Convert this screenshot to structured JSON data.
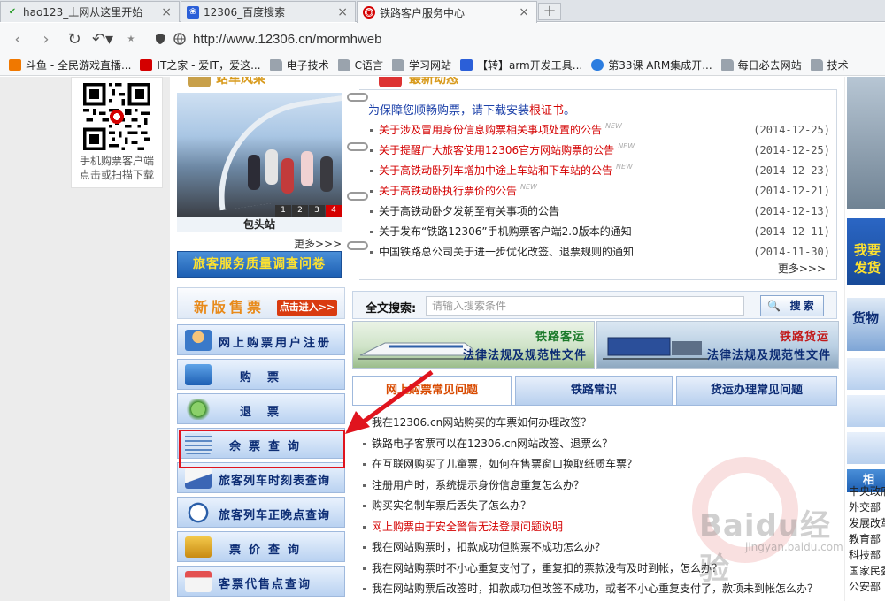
{
  "tabs": [
    {
      "title": "hao123_上网从这里开始",
      "favicon": "hao123-icon"
    },
    {
      "title": "12306_百度搜索",
      "favicon": "baidu-paw-icon"
    },
    {
      "title": "铁路客户服务中心",
      "favicon": "railway-icon"
    }
  ],
  "address": {
    "url": "http://www.12306.cn/mormhweb"
  },
  "bookmarks": [
    {
      "label": "斗鱼 - 全民游戏直播...",
      "icon": "douyu-icon"
    },
    {
      "label": "IT之家 - 爱IT，爱这...",
      "icon": "ithome-icon"
    },
    {
      "label": "电子技术",
      "icon": "folder-icon"
    },
    {
      "label": "C语言",
      "icon": "folder-icon"
    },
    {
      "label": "学习网站",
      "icon": "folder-icon"
    },
    {
      "label": "【转】arm开发工具...",
      "icon": "baidu-paw-icon"
    },
    {
      "label": "第33课 ARM集成开...",
      "icon": "video-icon"
    },
    {
      "label": "每日必去网站",
      "icon": "folder-icon"
    },
    {
      "label": "技术",
      "icon": "folder-icon"
    }
  ],
  "qr": {
    "caption_line1": "手机购票客户端",
    "caption_line2": "点击或扫描下载"
  },
  "headings": {
    "station_scenery": "站车风采",
    "latest_news": "最新动态"
  },
  "photo": {
    "caption": "包头站",
    "pages": [
      "1",
      "2",
      "3",
      "4"
    ],
    "active_page": "4",
    "more": "更多>>>"
  },
  "survey_button": "旅客服务质量调查问卷",
  "notice": {
    "prefix": "为保障您顺畅购票，请下载安装",
    "link": "根证书",
    "suffix": "。"
  },
  "news": [
    {
      "title": "关于涉及冒用身份信息购票相关事项处置的公告",
      "date": "(2014-12-25)",
      "hot": true,
      "new": "NEW"
    },
    {
      "title": "关于提醒广大旅客使用12306官方网站购票的公告",
      "date": "(2014-12-25)",
      "hot": true,
      "new": "NEW"
    },
    {
      "title": "关于高铁动卧列车增加中途上车站和下车站的公告",
      "date": "(2014-12-23)",
      "hot": true,
      "new": "NEW"
    },
    {
      "title": "关于高铁动卧执行票价的公告",
      "date": "(2014-12-21)",
      "hot": true,
      "new": "NEW"
    },
    {
      "title": "关于高铁动卧夕发朝至有关事项的公告",
      "date": "(2014-12-13)",
      "hot": false,
      "new": ""
    },
    {
      "title": "关于发布“铁路12306”手机购票客户端2.0版本的通知",
      "date": "(2014-12-11)",
      "hot": false,
      "new": ""
    },
    {
      "title": "中国铁路总公司关于进一步优化改签、退票规则的通知",
      "date": "(2014-11-30)",
      "hot": false,
      "new": ""
    }
  ],
  "news_more": "更多>>>",
  "new_booking": {
    "title": "新版售票",
    "button": "点击进入>>"
  },
  "menu": [
    {
      "label": "网上购票用户注册",
      "icon": "user-register-icon"
    },
    {
      "label": "购票",
      "icon": "ticket-computer-icon"
    },
    {
      "label": "退票",
      "icon": "refund-arrow-icon"
    },
    {
      "label": "余票查询",
      "icon": "remaining-tickets-icon"
    },
    {
      "label": "旅客列车时刻表查询",
      "icon": "train-timetable-icon"
    },
    {
      "label": "旅客列车正晚点查询",
      "icon": "clock-icon"
    },
    {
      "label": "票价查询",
      "icon": "yen-price-icon"
    },
    {
      "label": "客票代售点查询",
      "icon": "shop-icon"
    }
  ],
  "search": {
    "label": "全文搜索:",
    "placeholder": "请输入搜索条件",
    "button": "搜索"
  },
  "banners": [
    {
      "title": "铁路客运",
      "subtitle": "法律法规及规范性文件"
    },
    {
      "title": "铁路货运",
      "subtitle": "法律法规及规范性文件"
    }
  ],
  "faq_tabs": [
    "网上购票常见问题",
    "铁路常识",
    "货运办理常见问题"
  ],
  "faq": [
    {
      "q": "我在12306.cn网站购买的车票如何办理改签？",
      "hot": false
    },
    {
      "q": "铁路电子客票可以在12306.cn网站改签、退票么？",
      "hot": false
    },
    {
      "q": "在互联网购买了儿童票，如何在售票窗口换取纸质车票？",
      "hot": false
    },
    {
      "q": "注册用户时，系统提示身份信息重复怎么办？",
      "hot": false
    },
    {
      "q": "购买实名制车票后丢失了怎么办？",
      "hot": false
    },
    {
      "q": "网上购票由于安全警告无法登录问题说明",
      "hot": true
    },
    {
      "q": "我在网站购票时，扣款成功但购票不成功怎么办？",
      "hot": false
    },
    {
      "q": "我在网站购票时不小心重复支付了，重复扣的票款没有及时到帐，怎么办？",
      "hot": false
    },
    {
      "q": "我在网站购票后改签时，扣款成功但改签不成功，或者不小心重复支付了，款项未到帐怎么办？",
      "hot": false
    }
  ],
  "right_pane": {
    "btn1_line1": "我要",
    "btn1_line2": "发货",
    "cargo": "货物",
    "related_head": "相关",
    "links": [
      "中央政府",
      "外交部",
      "发展改革",
      "教育部",
      "科技部",
      "国家民委",
      "公安部"
    ]
  },
  "watermark": {
    "text": "Baidu经验",
    "url": "jingyan.baidu.com"
  },
  "colors": {
    "red": "#d40000",
    "navy": "#0c2c74",
    "highlight_box": "#e0141e"
  }
}
